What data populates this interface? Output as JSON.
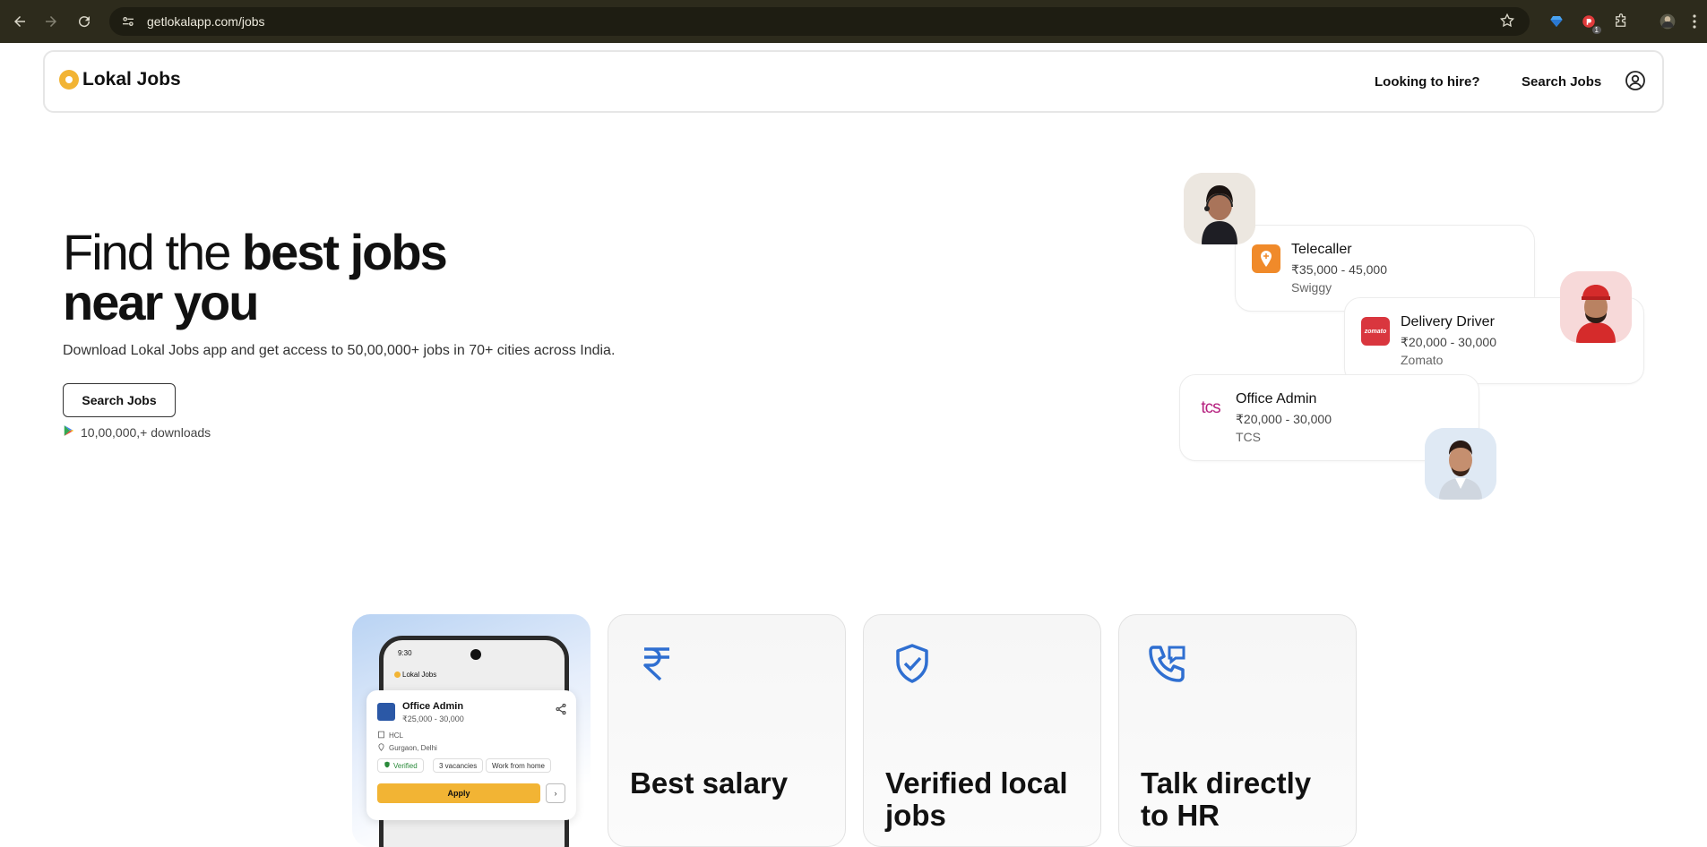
{
  "browser": {
    "url": "getlokalapp.com/jobs",
    "extension_badge": "1"
  },
  "header": {
    "logo_text": "Lokal Jobs",
    "nav": {
      "hire_label": "Looking to hire?",
      "search_label": "Search Jobs"
    }
  },
  "hero": {
    "title_light": "Find the ",
    "title_bold_1": "best jobs",
    "title_bold_2": "near you",
    "subtitle": "Download Lokal Jobs app and get access to 50,00,000+ jobs in 70+ cities across India.",
    "button_label": "Search Jobs",
    "downloads": "10,00,000,+ downloads"
  },
  "job_cards": [
    {
      "title": "Telecaller",
      "salary": "₹35,000 - 45,000",
      "company": "Swiggy",
      "logo_color": "#f08a2a"
    },
    {
      "title": "Delivery Driver",
      "salary": "₹20,000 - 30,000",
      "company": "Zomato",
      "logo_color": "#d9363e",
      "logo_text": "zomato"
    },
    {
      "title": "Office Admin",
      "salary": "₹20,000 - 30,000",
      "company": "TCS",
      "logo_text": "tcs",
      "logo_color": "#b6217f"
    }
  ],
  "phone": {
    "time": "9:30",
    "app_logo": "Lokal Jobs",
    "popup": {
      "title": "Office Admin",
      "salary": "₹25,000 - 30,000",
      "company": "HCL",
      "location": "Gurgaon, Delhi",
      "chips": [
        "Verified",
        "3 vacancies",
        "Work from home"
      ],
      "apply_label": "Apply",
      "next_label": "›"
    }
  },
  "features": [
    {
      "title": "Best salary",
      "icon": "rupee-icon"
    },
    {
      "title": "Verified local jobs",
      "icon": "verified-shield-icon"
    },
    {
      "title": "Talk directly to HR",
      "icon": "phone-chat-icon"
    }
  ],
  "colors": {
    "accent_yellow": "#f2b434",
    "feature_icon_blue": "#2f6fd1",
    "chrome_bg": "#2d2b1c"
  }
}
